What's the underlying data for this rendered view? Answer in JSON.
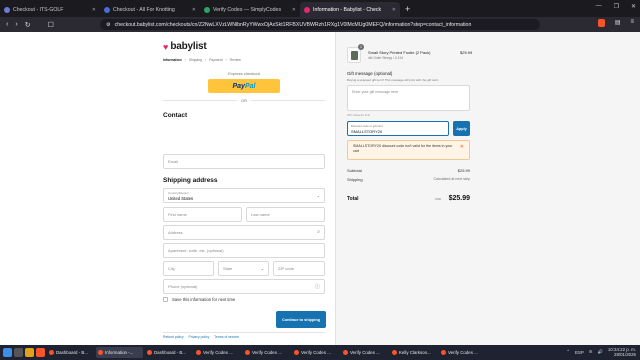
{
  "browser": {
    "tabs": [
      {
        "label": "Checkout - ITS-GOLF",
        "color": "#6c7bd8",
        "active": false
      },
      {
        "label": "Checkout - All For Knotting",
        "color": "#4a6bd8",
        "active": false
      },
      {
        "label": "Verify Codes — SimplyCodes",
        "color": "#2ca36b",
        "active": false
      },
      {
        "label": "Information - Babylist - Check",
        "color": "#e2296b",
        "active": true
      }
    ],
    "url": "checkout.babylist.com/checkouts/cn/Z2NwLXVzLWNlbnRyYWwxOjAxSkt1RFBXUVBWRzh1RXg1V0lMcMUg0MEFQ/information?step=contact_information"
  },
  "store": {
    "logo_text": "babylist",
    "breadcrumbs": [
      "Information",
      "Shipping",
      "Payment",
      "Review"
    ]
  },
  "express": {
    "label": "Express checkout",
    "paypal_1": "Pay",
    "paypal_2": "Pal",
    "or_label": "OR"
  },
  "contact": {
    "heading": "Contact",
    "email_placeholder": "Email"
  },
  "shipping": {
    "heading": "Shipping address",
    "country_label": "Country/Region",
    "country_value": "United States",
    "first_name": "First name",
    "last_name": "Last name",
    "address": "Address",
    "apartment": "Apartment, suite, etc. (optional)",
    "city": "City",
    "state": "State",
    "zip": "ZIP code",
    "phone": "Phone (optional)",
    "save_info": "Save this information for next time",
    "continue_label": "Continue to shipping"
  },
  "footer_links": [
    "Refund policy",
    "Privacy policy",
    "Terms of service"
  ],
  "summary": {
    "product_name": "Small Story Printed Footie (2 Pack)",
    "product_variant": "4th Order Sleepy / 0-3 M",
    "product_qty": "1",
    "product_price": "$25.99",
    "gift_title": "Gift message (optional)",
    "gift_hint": "Buying a wrapped gift item? This message will print with the gift card.",
    "gift_placeholder": "Enter your gift message here",
    "gift_limit": "200 character limit",
    "discount_label": "Discount code or gift card",
    "discount_value": "SMALLSTORY20",
    "apply_label": "Apply",
    "alert_text": "SMALLSTORY20 discount code isn't valid for the items in your cart",
    "subtotal_label": "Subtotal",
    "subtotal_value": "$25.99",
    "shipping_label": "Shipping",
    "shipping_value": "Calculated at next step",
    "total_label": "Total",
    "total_currency": "USD",
    "total_value": "$25.99"
  },
  "taskbar": {
    "tasks": [
      {
        "label": "Dashboard - B..."
      },
      {
        "label": "Information -..."
      },
      {
        "label": "Dashboard - B..."
      },
      {
        "label": "Verify Codes ..."
      },
      {
        "label": "Verify Codes ..."
      },
      {
        "label": "Verify Codes ..."
      },
      {
        "label": "Verify Codes ..."
      },
      {
        "label": "Kelly Clarkson..."
      },
      {
        "label": "Verify Codes ..."
      }
    ],
    "lang": "ESP",
    "time": "10:34:22 p. m.",
    "date": "28/01/2025"
  }
}
